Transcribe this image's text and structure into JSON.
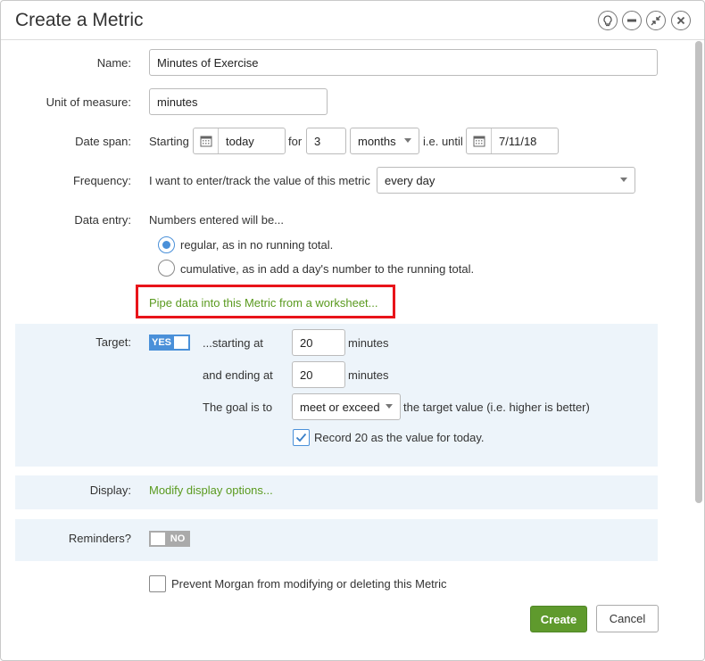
{
  "dialog": {
    "title": "Create a Metric",
    "controls": [
      "lightbulb-icon",
      "minimize-icon",
      "collapse-icon",
      "close-icon"
    ]
  },
  "form": {
    "name": {
      "label": "Name:",
      "value": "Minutes of Exercise"
    },
    "unit": {
      "label": "Unit of measure:",
      "value": "minutes"
    },
    "date_span": {
      "label": "Date span:",
      "starting_text": "Starting",
      "start_value": "today",
      "for_text": "for",
      "duration": "3",
      "period": "months",
      "until_text": "i.e. until",
      "end_value": "7/11/18"
    },
    "frequency": {
      "label": "Frequency:",
      "prefix": "I want to enter/track the value of this metric",
      "value": "every day"
    },
    "data_entry": {
      "label": "Data entry:",
      "intro": "Numbers entered will be...",
      "options": [
        {
          "label": "regular, as in no running total.",
          "selected": true
        },
        {
          "label": "cumulative, as in add a day's number to the running total.",
          "selected": false
        }
      ],
      "pipe_link": "Pipe data into this Metric from a worksheet..."
    },
    "target": {
      "label": "Target:",
      "toggle": "YES",
      "starting_text": "...starting at",
      "start_value": "20",
      "start_unit": "minutes",
      "ending_text": "and ending at",
      "end_value": "20",
      "end_unit": "minutes",
      "goal_text": "The goal is to",
      "goal_value": "meet or exceed",
      "goal_suffix": "the target value (i.e. higher is better)",
      "record_label": "Record 20 as the value for today.",
      "record_checked": true
    },
    "display": {
      "label": "Display:",
      "link": "Modify display options..."
    },
    "reminders": {
      "label": "Reminders?",
      "toggle": "NO"
    },
    "prevent": {
      "label": "Prevent Morgan from modifying or deleting this Metric",
      "checked": false
    }
  },
  "buttons": {
    "create": "Create",
    "cancel": "Cancel"
  },
  "colors": {
    "accent_green": "#5f9a2d",
    "link_green": "#5a9a1f",
    "toggle_blue": "#4a90d9",
    "highlight_red": "#e8141a",
    "panel_bg": "#edf4fa"
  }
}
